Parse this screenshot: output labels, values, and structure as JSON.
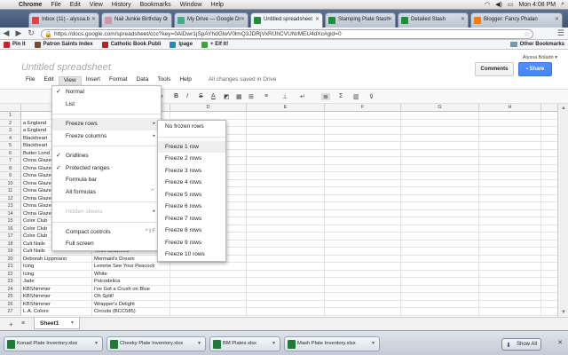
{
  "menubar": {
    "app": "Chrome",
    "items": [
      "File",
      "Edit",
      "View",
      "History",
      "Bookmarks",
      "Window",
      "Help"
    ],
    "clock": "Mon 4:08 PM"
  },
  "tabs": [
    {
      "label": "Inbox (11) - alyssa.b",
      "color": "#d44"
    },
    {
      "label": "Nail Junkie Birthday C",
      "color": "#c9a"
    },
    {
      "label": "My Drive — Google Dr",
      "color": "#4a8"
    },
    {
      "label": "Untitled spreadsheet",
      "color": "#1f8e3a"
    },
    {
      "label": "Stamping Plate Stash",
      "color": "#1f8e3a"
    },
    {
      "label": "Detailed Stash",
      "color": "#1f8e3a"
    },
    {
      "label": "Blogger: Fancy Phalan",
      "color": "#f57d00"
    }
  ],
  "omnibox": {
    "url": "https://docs.google.com/spreadsheet/ccc?key=0AlDwr1jSpAYhdGlwV0lmQ3JDRjVxRUhCVUNrMEU4dXc#gid=0"
  },
  "bookmarks": {
    "items": [
      "Pin It",
      "Patron Saints Index",
      "Catholic Book Publi",
      "Ipage",
      "+ Elf It!"
    ],
    "other": "Other Bookmarks"
  },
  "docs": {
    "title": "Untitled spreadsheet",
    "user": "Alyssa Bolado ▾",
    "comments": "Comments",
    "share": "Share",
    "menu": [
      "File",
      "Edit",
      "View",
      "Insert",
      "Format",
      "Data",
      "Tools",
      "Help"
    ],
    "saved": "All changes saved in Drive"
  },
  "grid": {
    "columns": [
      "B",
      "C",
      "D",
      "E",
      "F",
      "G",
      "H",
      "I"
    ],
    "rows": [
      {
        "n": "1",
        "b": "B",
        "c": ""
      },
      {
        "n": "2",
        "b": "a England",
        "c": ""
      },
      {
        "n": "3",
        "b": "a England",
        "c": ""
      },
      {
        "n": "4",
        "b": "Blackheart",
        "c": ""
      },
      {
        "n": "5",
        "b": "Blackheart",
        "c": ""
      },
      {
        "n": "6",
        "b": "Butter Lond",
        "c": ""
      },
      {
        "n": "7",
        "b": "China Glaze",
        "c": ""
      },
      {
        "n": "8",
        "b": "China Glaze",
        "c": ""
      },
      {
        "n": "9",
        "b": "China Glaze",
        "c": ""
      },
      {
        "n": "10",
        "b": "China Glaze",
        "c": ""
      },
      {
        "n": "11",
        "b": "China Glaze",
        "c": ""
      },
      {
        "n": "12",
        "b": "China Glaze",
        "c": ""
      },
      {
        "n": "13",
        "b": "China Glaze",
        "c": ""
      },
      {
        "n": "14",
        "b": "China Glaze",
        "c": ""
      },
      {
        "n": "15",
        "b": "Color Club",
        "c": ""
      },
      {
        "n": "16",
        "b": "Color Club",
        "c": ""
      },
      {
        "n": "17",
        "b": "Color Club",
        "c": ""
      },
      {
        "n": "18",
        "b": "Cult Nails",
        "c": ""
      },
      {
        "n": "19",
        "b": "Cult Nails",
        "c": "Toxic Seaweed"
      },
      {
        "n": "20",
        "b": "Deborah Lippmann",
        "c": "Mermaid's Dream"
      },
      {
        "n": "21",
        "b": "Icing",
        "c": "Lemme See Your Peacock"
      },
      {
        "n": "22",
        "b": "Icing",
        "c": "White"
      },
      {
        "n": "23",
        "b": "Jade",
        "c": "Psicodelica"
      },
      {
        "n": "24",
        "b": "KBShimmer",
        "c": "I've Got a Crush on Blue"
      },
      {
        "n": "25",
        "b": "KBShimmer",
        "c": "Oh Split!"
      },
      {
        "n": "26",
        "b": "KBShimmer",
        "c": "Wrapper's Delight"
      },
      {
        "n": "27",
        "b": "L.A. Colors",
        "c": "Circuits (BCC585)"
      }
    ]
  },
  "view_menu": {
    "items": [
      {
        "label": "Normal",
        "check": "✓",
        "arrow": "",
        "shortcut": "",
        "disabled": false,
        "sep_after": false
      },
      {
        "label": "List",
        "check": "",
        "arrow": "",
        "shortcut": "",
        "disabled": false,
        "sep_after": true
      },
      {
        "label": "Freeze rows",
        "check": "",
        "arrow": "▸",
        "shortcut": "",
        "disabled": false,
        "sep_after": false
      },
      {
        "label": "Freeze columns",
        "check": "",
        "arrow": "▸",
        "shortcut": "",
        "disabled": false,
        "sep_after": true
      },
      {
        "label": "Gridlines",
        "check": "✓",
        "arrow": "",
        "shortcut": "",
        "disabled": false,
        "sep_after": false
      },
      {
        "label": "Protected ranges",
        "check": "✓",
        "arrow": "",
        "shortcut": "",
        "disabled": false,
        "sep_after": false
      },
      {
        "label": "Formula bar",
        "check": "",
        "arrow": "",
        "shortcut": "",
        "disabled": false,
        "sep_after": false
      },
      {
        "label": "All formulas",
        "check": "",
        "arrow": "",
        "shortcut": "^`",
        "disabled": false,
        "sep_after": true
      },
      {
        "label": "Hidden sheets",
        "check": "",
        "arrow": "▸",
        "shortcut": "",
        "disabled": true,
        "sep_after": true
      },
      {
        "label": "Compact controls",
        "check": "",
        "arrow": "",
        "shortcut": "^⇧F",
        "disabled": false,
        "sep_after": false
      },
      {
        "label": "Full screen",
        "check": "",
        "arrow": "",
        "shortcut": "",
        "disabled": false,
        "sep_after": false
      }
    ],
    "selected_index": 2
  },
  "freeze_submenu": {
    "items": [
      "No frozen rows",
      "Freeze 1 row",
      "Freeze 2 rows",
      "Freeze 3 rows",
      "Freeze 4 rows",
      "Freeze 5 rows",
      "Freeze 6 rows",
      "Freeze 7 rows",
      "Freeze 8 rows",
      "Freeze 9 rows",
      "Freeze 10 rows"
    ],
    "highlighted_index": 1
  },
  "sheet_tabs": {
    "active": "Sheet1"
  },
  "downloads": {
    "items": [
      "Konad Plate Inventory.xlsx",
      "Cheeky Plate Inventory.xlsx",
      "BM Plates.xlsx",
      "Mash Plate Inventory.xlsx"
    ],
    "show_all": "Show All"
  }
}
